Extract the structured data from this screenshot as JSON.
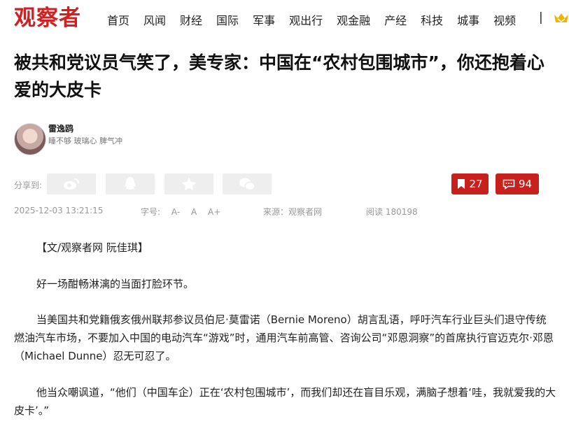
{
  "site": {
    "logo": "观察者"
  },
  "nav": {
    "items": [
      "首页",
      "风闻",
      "财经",
      "国际",
      "军事",
      "观出行",
      "观金融",
      "产经",
      "科技",
      "城事",
      "视频"
    ],
    "separator": "|"
  },
  "article": {
    "title": "被共和党议员气笑了，美专家：中国在“农村包围城市”，你还抱着心爱的大皮卡",
    "author": {
      "name": "雷逸鸥",
      "motto": "睡不够 玻璃心 脾气冲"
    },
    "share": {
      "label": "分享到:",
      "buttons": [
        "weibo-icon",
        "qq-icon",
        "qzone-icon",
        "wechat-icon"
      ]
    },
    "bookmark_count": "27",
    "comment_count": "94",
    "meta": {
      "datetime": "2025-12-03 13:21:15",
      "font_label": "字号:",
      "font_sizes": [
        "A-",
        "A",
        "A+"
      ],
      "source": "来源：观察者网",
      "reads": "阅读 180198"
    },
    "paragraphs": [
      "【文/观察者网 阮佳琪】",
      "好一场酣畅淋漓的当面打脸环节。",
      "当美国共和党籍俄亥俄州联邦参议员伯尼·莫雷诺（Bernie Moreno）胡言乱语，呼吁汽车行业巨头们退守传统燃油汽车市场，不要加入中国的电动汽车“游戏”时，通用汽车前高管、咨询公司“邓恩洞察”的首席执行官迈克尔·邓恩（Michael Dunne）忍无可忍了。",
      "他当众嘲讽道，“他们（中国车企）正在‘农村包围城市’，而我们却还在盲目乐观，满脑子想着‘哇，我就爱我的大皮卡’。”"
    ]
  },
  "colors": {
    "brand_red": "#d21f22",
    "button_red": "#c8201c",
    "vip_gold": "#f0b400"
  }
}
